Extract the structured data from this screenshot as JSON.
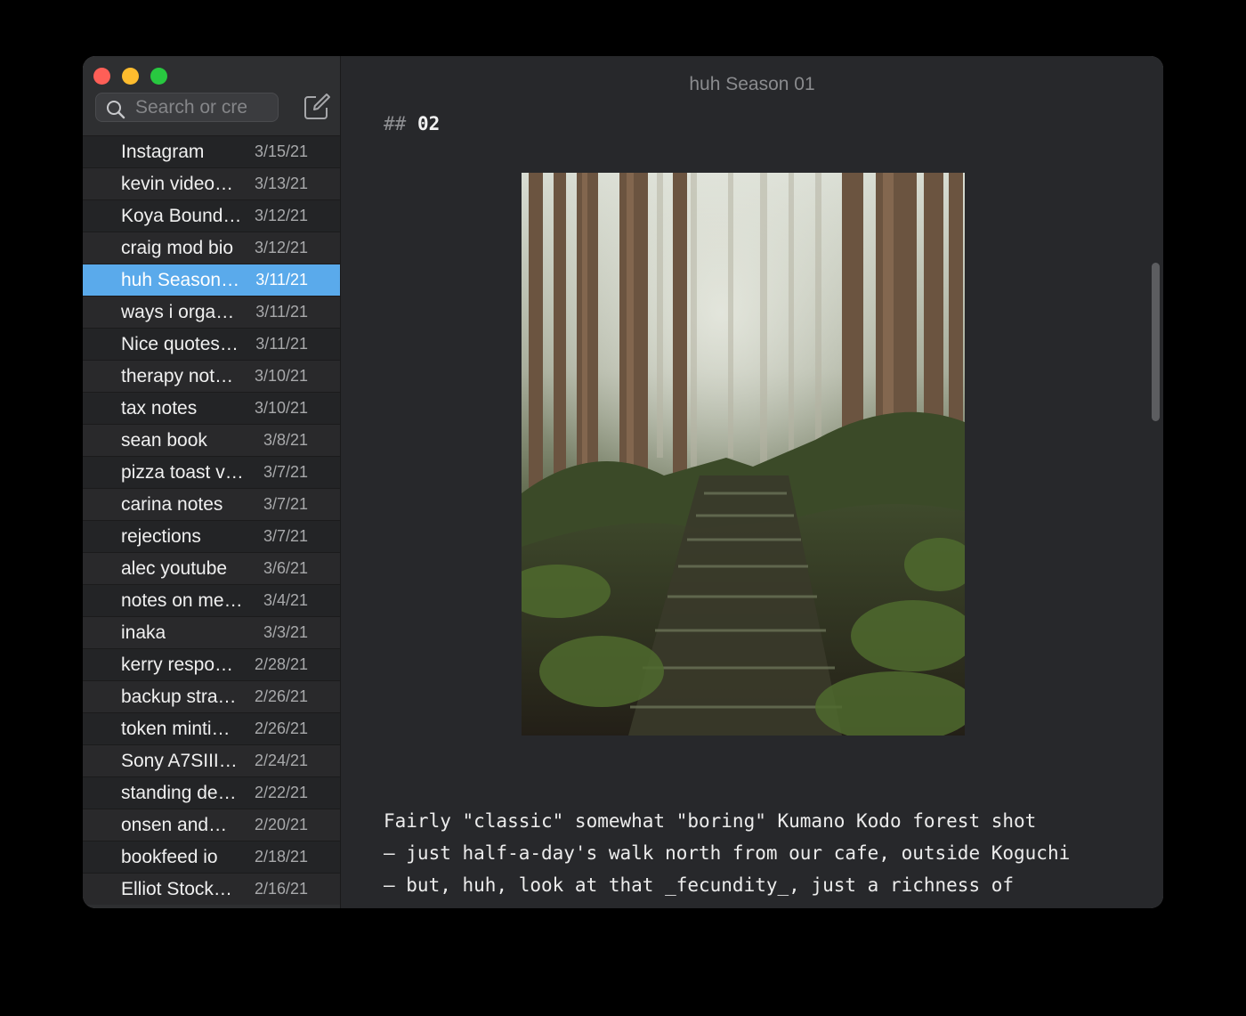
{
  "search": {
    "placeholder": "Search or create"
  },
  "notes": [
    {
      "title": "Instagram",
      "date": "3/15/21"
    },
    {
      "title": "kevin video…",
      "date": "3/13/21"
    },
    {
      "title": "Koya Bound…",
      "date": "3/12/21"
    },
    {
      "title": "craig mod bio",
      "date": "3/12/21"
    },
    {
      "title": "huh Season…",
      "date": "3/11/21",
      "selected": true
    },
    {
      "title": "ways i orga…",
      "date": "3/11/21"
    },
    {
      "title": "Nice quotes…",
      "date": "3/11/21"
    },
    {
      "title": "therapy not…",
      "date": "3/10/21"
    },
    {
      "title": "tax notes",
      "date": "3/10/21"
    },
    {
      "title": "sean book",
      "date": "3/8/21"
    },
    {
      "title": "pizza toast v…",
      "date": "3/7/21"
    },
    {
      "title": "carina notes",
      "date": "3/7/21"
    },
    {
      "title": "rejections",
      "date": "3/7/21"
    },
    {
      "title": "alec youtube",
      "date": "3/6/21"
    },
    {
      "title": "notes on me…",
      "date": "3/4/21"
    },
    {
      "title": "inaka",
      "date": "3/3/21"
    },
    {
      "title": "kerry respo…",
      "date": "2/28/21"
    },
    {
      "title": "backup stra…",
      "date": "2/26/21"
    },
    {
      "title": "token minti…",
      "date": "2/26/21"
    },
    {
      "title": "Sony A7SIII…",
      "date": "2/24/21"
    },
    {
      "title": "standing de…",
      "date": "2/22/21"
    },
    {
      "title": "onsen and…",
      "date": "2/20/21"
    },
    {
      "title": "bookfeed io",
      "date": "2/18/21"
    },
    {
      "title": "Elliot Stock…",
      "date": "2/16/21"
    }
  ],
  "editor": {
    "window_title": "huh Season 01",
    "heading_marker": "##",
    "heading_text": "02",
    "body_lines": [
      "Fairly \"classic\" somewhat \"boring\" Kumano Kodo forest shot",
      "— just half-a-day's walk north from our cafe, outside Koguchi",
      "— but, huh, look at that _fecundity_, just a richness of"
    ]
  },
  "colors": {
    "accent": "#5aaaeb",
    "background": "#27282b",
    "sidebar": "#2e2f31"
  },
  "icons": {
    "search": "magnifier-icon",
    "compose": "compose-icon"
  }
}
